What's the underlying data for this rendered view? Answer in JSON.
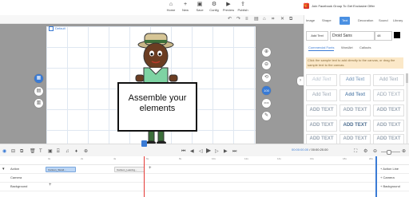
{
  "topbar": {
    "buttons": [
      {
        "label": "Home",
        "icon": "home-icon"
      },
      {
        "label": "New",
        "icon": "new-file-icon"
      },
      {
        "label": "Save",
        "icon": "save-icon"
      },
      {
        "label": "Config",
        "icon": "gear-icon"
      },
      {
        "label": "Preview",
        "icon": "play-icon"
      },
      {
        "label": "Publish",
        "icon": "publish-icon"
      }
    ],
    "promo": "Join Facebook Group To Get Exclusive Offer"
  },
  "canvas": {
    "scene_label": "Default",
    "speech_text": "Assemble your elements"
  },
  "side_tools": {
    "right": [
      "⊕",
      "⊖",
      "⟲",
      "100",
      "0/16",
      "✎"
    ],
    "left": [
      "▦",
      "▤",
      "▥"
    ]
  },
  "right_panel": {
    "tabs": [
      "Image",
      "Shape",
      "Text",
      "Decoration",
      "Sound",
      "Library"
    ],
    "active_tab": "Text",
    "add_text_label": "Add Text",
    "font": "Droid Sans",
    "font_size": "48",
    "subtabs": [
      "Commercial Fonts",
      "WordArt",
      "Callouts"
    ],
    "hint": "Click the sample text to add directly to the canvas, or drag the sample text to the canvas.",
    "samples": [
      [
        "Add Text",
        "Add Text",
        "Add Text"
      ],
      [
        "Add Text",
        "Add Text",
        "ADD TEXT"
      ],
      [
        "ADD TEXT",
        "ADD TEXT",
        "ADD TEXT"
      ],
      [
        "ADD TEXT",
        "ADD TEXT",
        "ADD TEXT"
      ],
      [
        "ADD TEXT",
        "ADD TEXT",
        "ADD TEXT"
      ]
    ]
  },
  "timeline": {
    "current_time": "00:00:00.00",
    "total_time": "00:00:20.00",
    "ruler": [
      "0s",
      "2s",
      "4s",
      "6s",
      "8s",
      "10s",
      "12s",
      "14s",
      "16s",
      "18s",
      "20s"
    ],
    "tracks": [
      {
        "name": "Action",
        "clips": [
          "Cartoon_Stand...",
          "Cartoon_Leaning..."
        ],
        "right": "Action Line"
      },
      {
        "name": "Camera",
        "clips": [],
        "right": "Camera"
      },
      {
        "name": "Background",
        "clips": [],
        "right": "Background"
      }
    ]
  },
  "colors": {
    "accent": "#3a7bd5",
    "stage_bg": "#9a9a9a",
    "playhead": "#e53935",
    "clip_action": "#bcd6f5"
  }
}
